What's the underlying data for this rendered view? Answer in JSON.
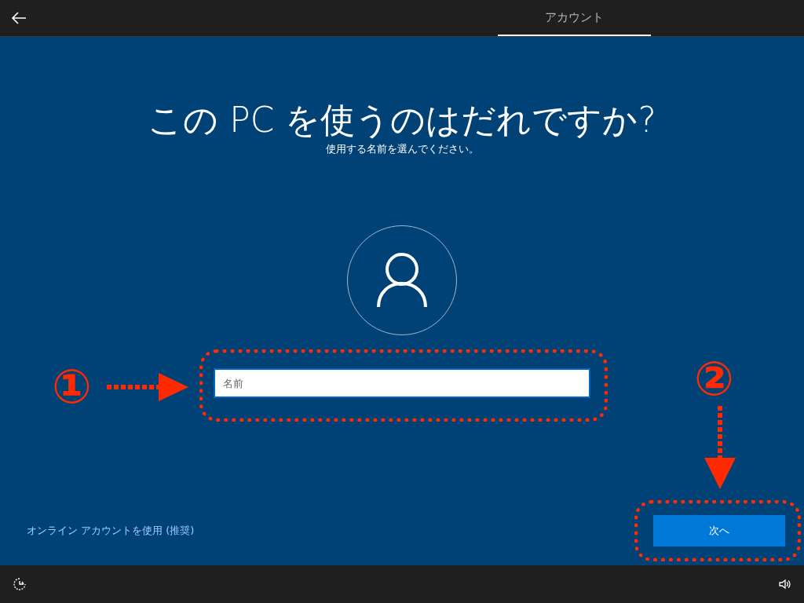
{
  "tabs": [
    {
      "label": "アカウント",
      "selected": true
    }
  ],
  "title": "この PC を使うのはだれですか?",
  "subtitle": "使用する名前を選んでください。",
  "name_field": {
    "placeholder": "名前"
  },
  "online_account_link": "オンライン アカウントを使用 (推奨)",
  "next_button": "次へ",
  "annotations": [
    {
      "label": "①"
    },
    {
      "label": "②"
    }
  ]
}
